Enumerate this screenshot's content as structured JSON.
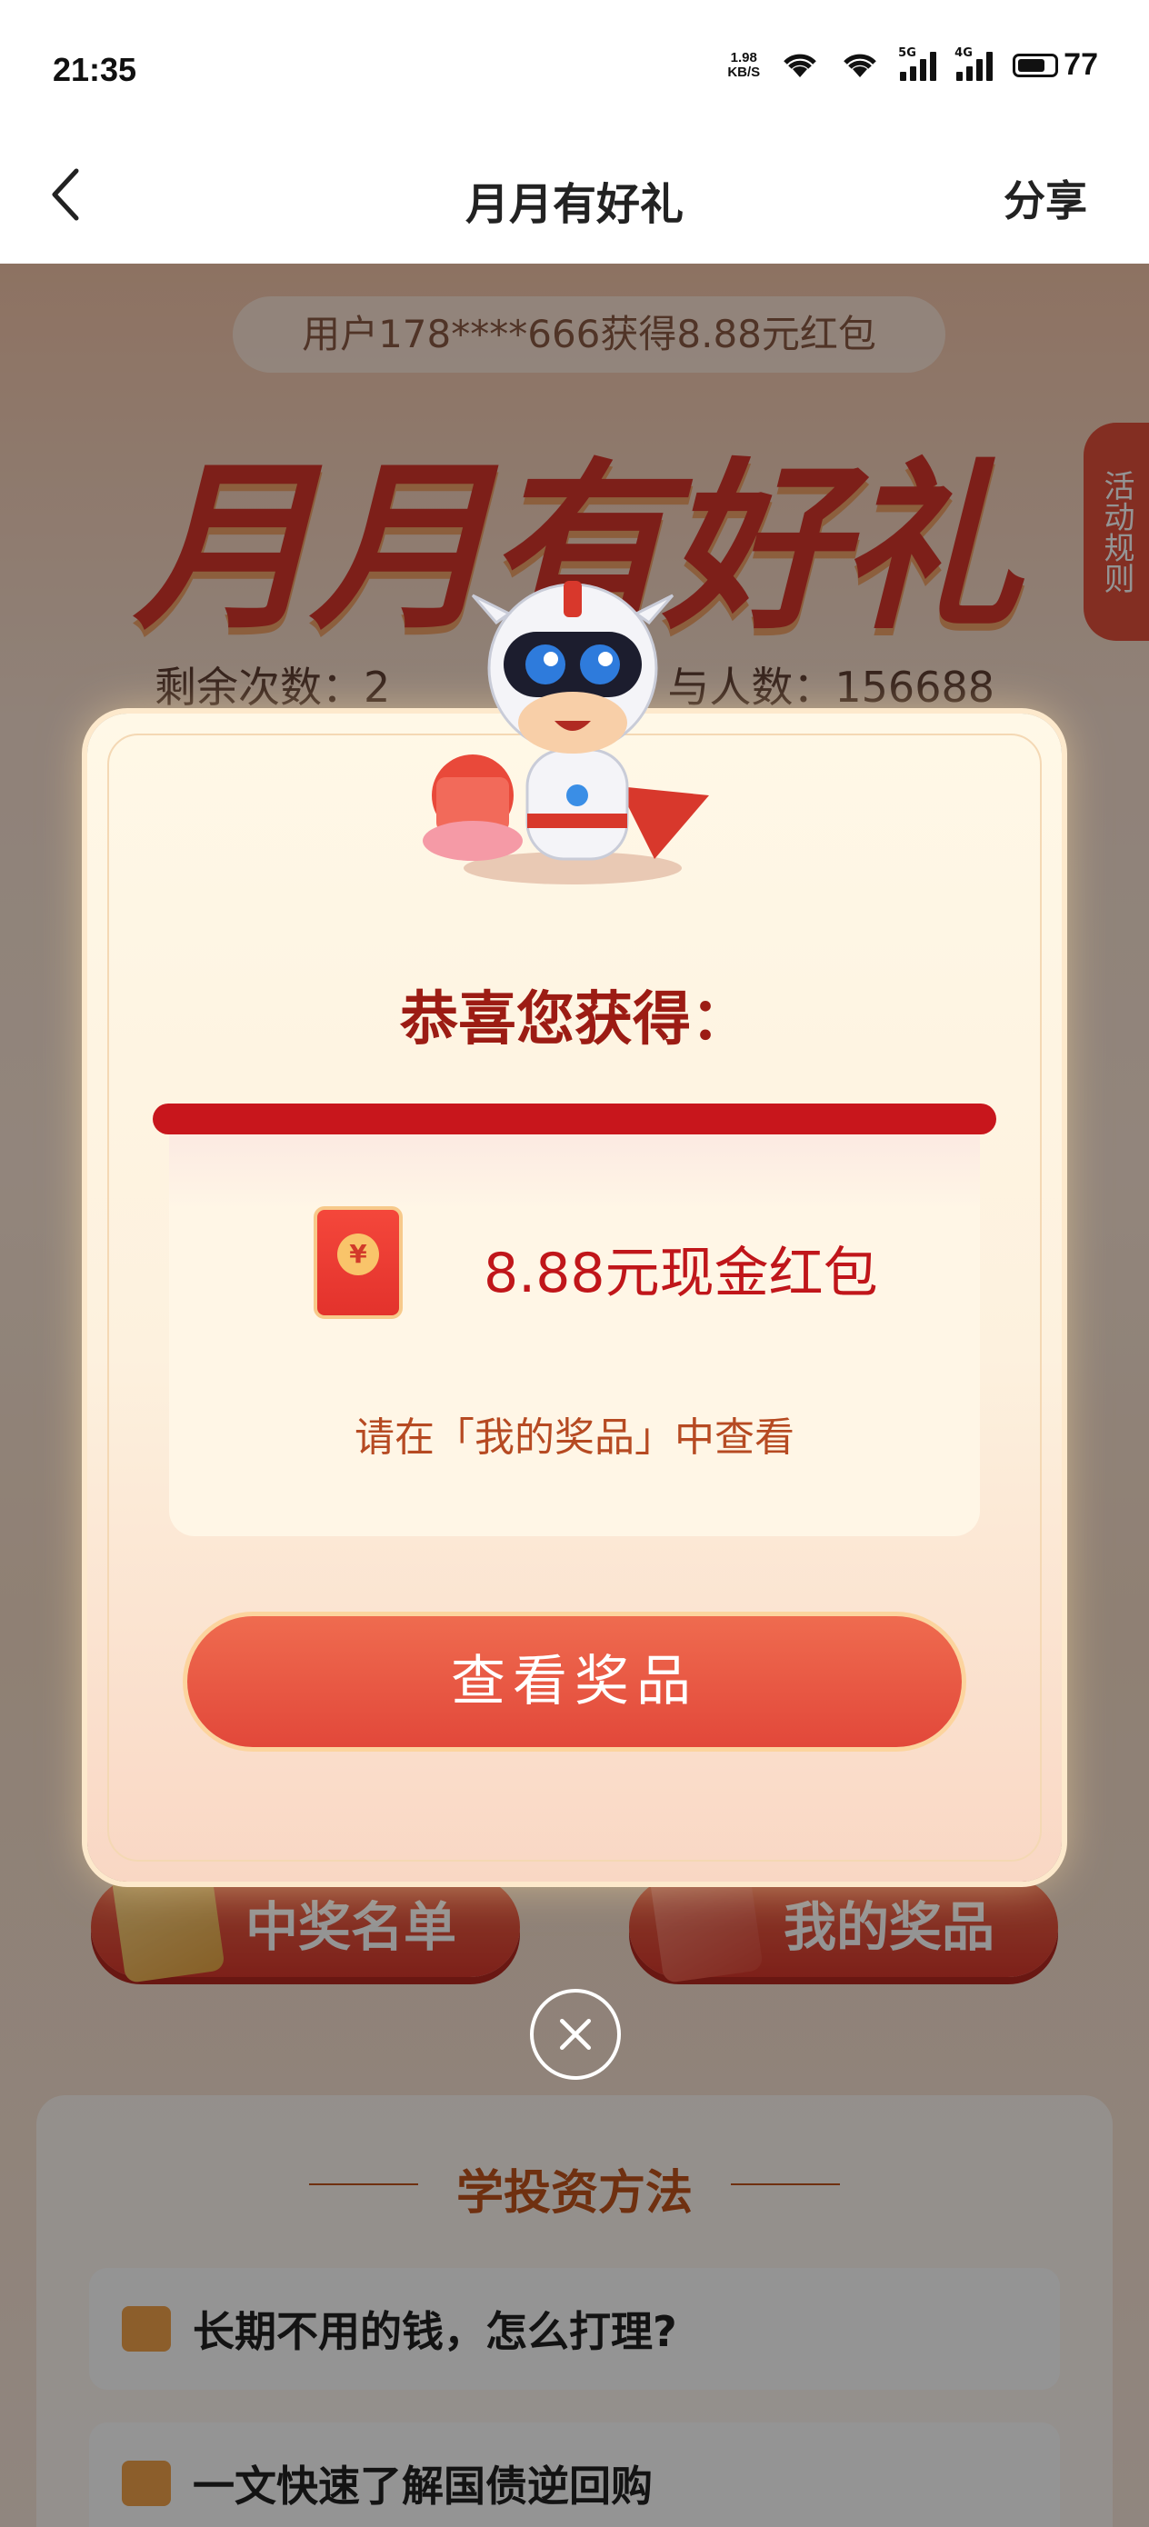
{
  "status_bar": {
    "time": "21:35",
    "net_speed_value": "1.98",
    "net_speed_unit": "KB/S",
    "signal_1_tag": "5G",
    "signal_2_tag": "4G",
    "battery": "77",
    "battery_level": 0.77
  },
  "nav": {
    "back_icon": "chevron-left-icon",
    "title": "月月有好礼",
    "share": "分享"
  },
  "background_page": {
    "ticker": "用户178****666获得8.88元红包",
    "hero_title": "月月有好礼",
    "rules_tab": "活动规则",
    "remaining": "剩余次数：2",
    "participants": "与人数：156688",
    "winners_button": "中奖名单",
    "my_prizes_button": "我的奖品",
    "learn_title": "学投资方法",
    "articles": [
      {
        "icon": "thumbs-up-icon",
        "title": "长期不用的钱，怎么打理?"
      },
      {
        "icon": "thumbs-up-icon",
        "title": "一文快速了解国债逆回购"
      }
    ]
  },
  "modal": {
    "title": "恭喜您获得：",
    "prize": {
      "icon": "red-envelope-icon",
      "icon_symbol": "¥",
      "text": "8.88元现金红包"
    },
    "hint": "请在「我的奖品」中查看",
    "button": "查看奖品",
    "close_icon": "close-circle-icon"
  },
  "colors": {
    "accent_red": "#c0161a",
    "title_red": "#9c1c14",
    "button_red": "#e2483a",
    "hint_orange": "#b64a22"
  }
}
